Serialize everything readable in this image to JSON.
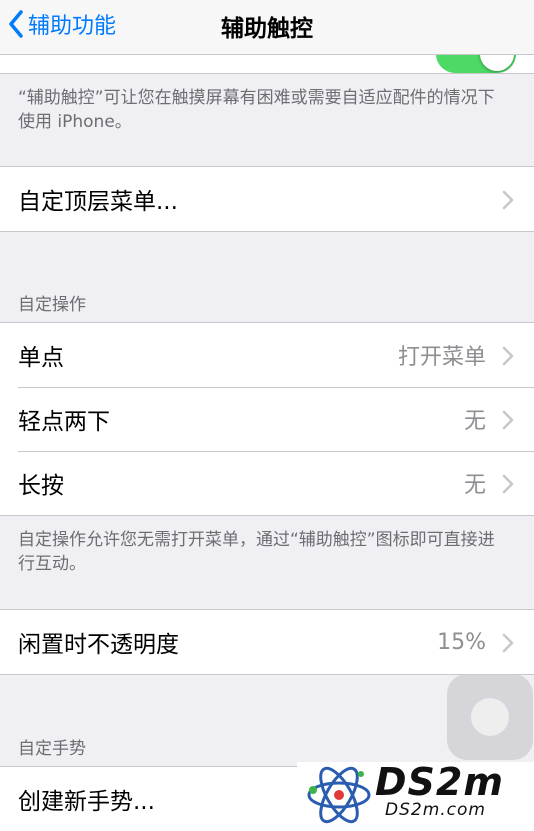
{
  "nav": {
    "back_label": "辅助功能",
    "title": "辅助触控"
  },
  "main": {
    "toggle_on": true,
    "description": "“辅助触控”可让您在触摸屏幕有困难或需要自适应配件的情况下使用 iPhone。",
    "top_menu_label": "自定顶层菜单...",
    "custom_actions_header": "自定操作",
    "custom_actions": [
      {
        "label": "单点",
        "value": "打开菜单"
      },
      {
        "label": "轻点两下",
        "value": "无"
      },
      {
        "label": "长按",
        "value": "无"
      }
    ],
    "custom_actions_footer": "自定操作允许您无需打开菜单，通过“辅助触控”图标即可直接进行互动。",
    "idle_opacity_label": "闲置时不透明度",
    "idle_opacity_value": "15%",
    "custom_gestures_header": "自定手势",
    "create_gesture_label": "创建新手势..."
  },
  "watermark": {
    "text": "DS2m",
    "url": "DS2m.com"
  },
  "colors": {
    "accent": "#007aff",
    "toggle_green": "#4cd964"
  }
}
